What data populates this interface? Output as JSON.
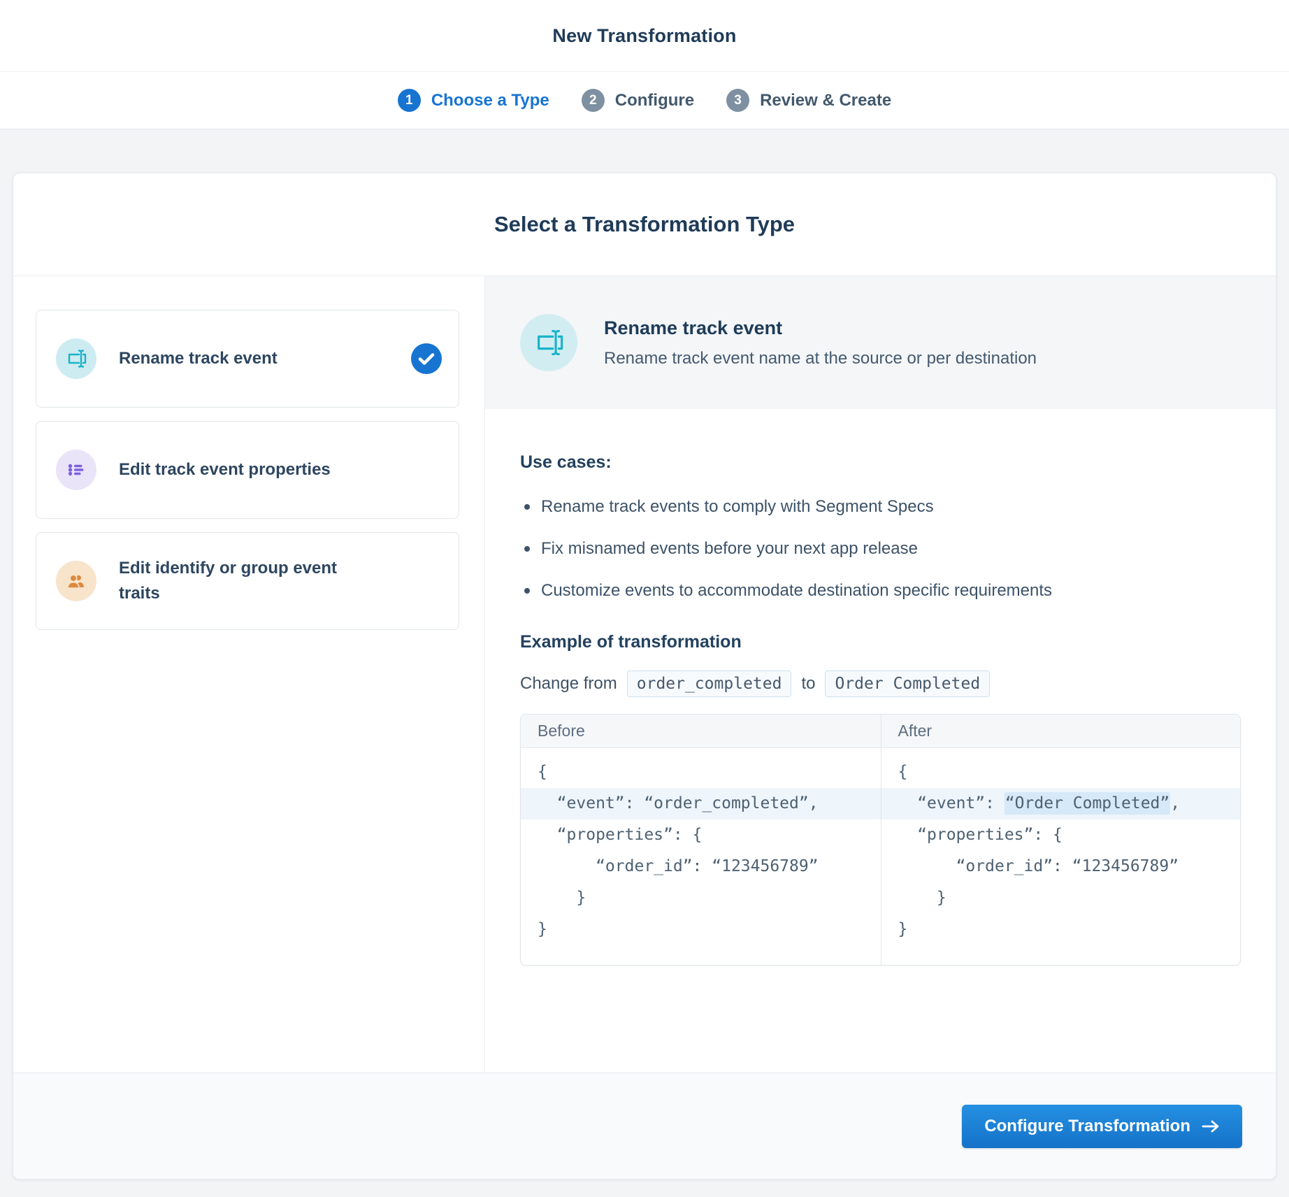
{
  "header": {
    "title": "New Transformation"
  },
  "steps": [
    {
      "number": "1",
      "label": "Choose a Type",
      "state": "active"
    },
    {
      "number": "2",
      "label": "Configure",
      "state": "inactive"
    },
    {
      "number": "3",
      "label": "Review & Create",
      "state": "inactive"
    }
  ],
  "card": {
    "title": "Select a Transformation Type",
    "options": [
      {
        "label": "Rename track event",
        "icon": "rename-icon",
        "selected": true
      },
      {
        "label": "Edit track event properties",
        "icon": "list-properties-icon",
        "selected": false
      },
      {
        "label": "Edit identify or group event traits",
        "icon": "people-icon",
        "selected": false
      }
    ],
    "detail": {
      "title": "Rename track event",
      "subtitle": "Rename track event name at the source or per destination",
      "use_cases_heading": "Use cases:",
      "use_cases": [
        "Rename track events to comply with Segment Specs",
        "Fix misnamed events before your next app release",
        "Customize events to accommodate destination specific requirements"
      ],
      "example_heading": "Example of transformation",
      "change": {
        "prefix": "Change from",
        "from_code": "order_completed",
        "middle": "to",
        "to_code": "Order Completed"
      },
      "compare": {
        "before_label": "Before",
        "after_label": "After",
        "before_lines": [
          "{",
          "  “event”: “order_completed”,",
          "  “properties”: {",
          "      “order_id”: “123456789”",
          "    }",
          "}"
        ],
        "after_line_0": "{",
        "after_event_pre": "  “event”: ",
        "after_event_highlight": "“Order Completed”",
        "after_event_post": ",",
        "after_lines_rest": [
          "  “properties”: {",
          "      “order_id”: “123456789”",
          "    }",
          "}"
        ]
      }
    },
    "footer": {
      "button_label": "Configure Transformation"
    }
  },
  "colors": {
    "accent_blue": "#1774d1",
    "teal_icon": "#18b3c9",
    "purple_icon": "#7c61dd",
    "orange_icon": "#dd8a3e",
    "row_highlight": "#eef5fb",
    "token_highlight": "#d6e9f8"
  }
}
